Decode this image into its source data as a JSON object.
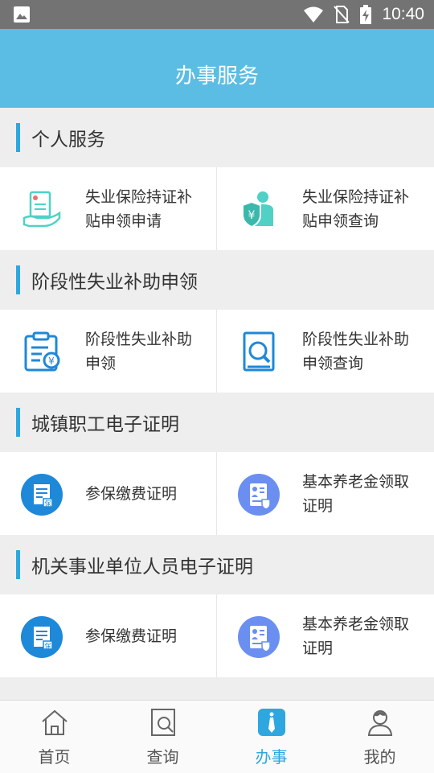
{
  "status_bar": {
    "time": "10:40"
  },
  "header": {
    "title": "办事服务"
  },
  "sections": [
    {
      "title": "个人服务",
      "items": [
        {
          "label": "失业保险持证补贴申领申请",
          "icon": "certificate-hand-icon"
        },
        {
          "label": "失业保险持证补贴申领查询",
          "icon": "person-yen-shield-icon"
        }
      ]
    },
    {
      "title": "阶段性失业补助申领",
      "items": [
        {
          "label": "阶段性失业补助申领",
          "icon": "clipboard-yen-icon"
        },
        {
          "label": "阶段性失业补助申领查询",
          "icon": "document-search-icon"
        }
      ]
    },
    {
      "title": "城镇职工电子证明",
      "items": [
        {
          "label": "参保缴费证明",
          "icon": "insurance-certificate-icon"
        },
        {
          "label": "基本养老金领取证明",
          "icon": "pension-certificate-icon"
        }
      ]
    },
    {
      "title": "机关事业单位人员电子证明",
      "items": [
        {
          "label": "参保缴费证明",
          "icon": "insurance-certificate-icon"
        },
        {
          "label": "基本养老金领取证明",
          "icon": "pension-certificate-icon"
        }
      ]
    }
  ],
  "tabs": [
    {
      "label": "首页",
      "icon": "home-icon"
    },
    {
      "label": "查询",
      "icon": "search-doc-icon"
    },
    {
      "label": "办事",
      "icon": "tie-icon",
      "active": true
    },
    {
      "label": "我的",
      "icon": "user-icon"
    }
  ],
  "colors": {
    "header": "#5bbde3",
    "accent": "#2ea7e0",
    "teal": "#4fd1c5",
    "periwinkle": "#6b8ff0"
  }
}
